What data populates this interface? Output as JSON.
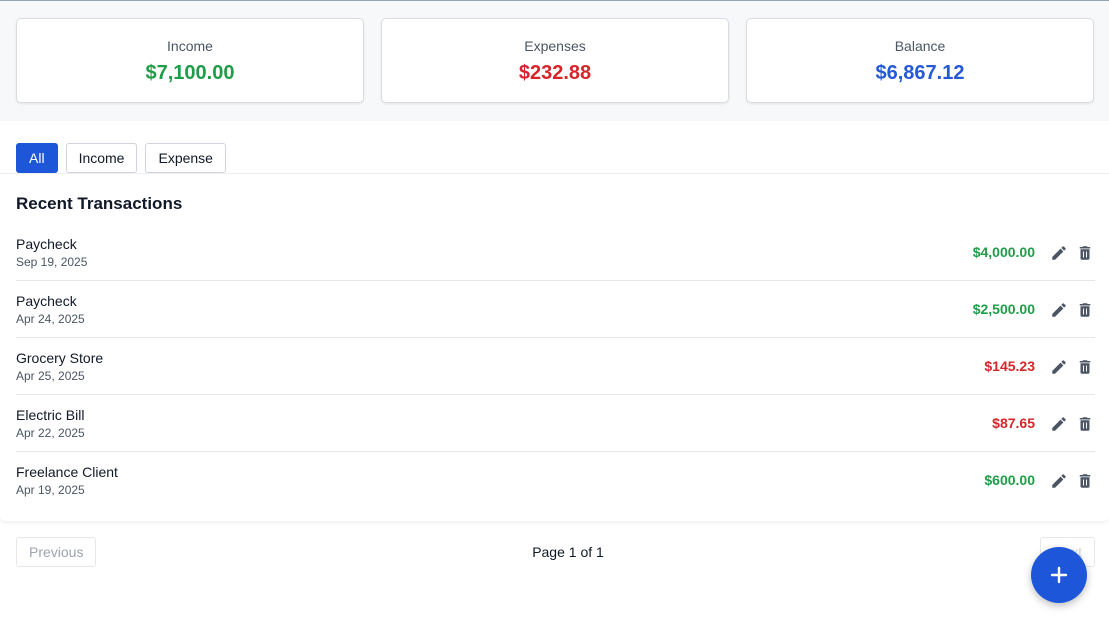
{
  "colors": {
    "income": "#1f9d48",
    "expense": "#d6252b",
    "balance": "#2559d6",
    "accent": "#1d56d8",
    "icon": "#4b5563"
  },
  "summary": {
    "income": {
      "label": "Income",
      "value": "$7,100.00"
    },
    "expenses": {
      "label": "Expenses",
      "value": "$232.88"
    },
    "balance": {
      "label": "Balance",
      "value": "$6,867.12"
    }
  },
  "filters": {
    "all": "All",
    "income": "Income",
    "expense": "Expense",
    "selected": "All"
  },
  "transactions": {
    "title": "Recent Transactions",
    "items": [
      {
        "name": "Paycheck",
        "date": "Sep 19, 2025",
        "amount": "$4,000.00",
        "type": "income"
      },
      {
        "name": "Paycheck",
        "date": "Apr 24, 2025",
        "amount": "$2,500.00",
        "type": "income"
      },
      {
        "name": "Grocery Store",
        "date": "Apr 25, 2025",
        "amount": "$145.23",
        "type": "expense"
      },
      {
        "name": "Electric Bill",
        "date": "Apr 22, 2025",
        "amount": "$87.65",
        "type": "expense"
      },
      {
        "name": "Freelance Client",
        "date": "Apr 19, 2025",
        "amount": "$600.00",
        "type": "income"
      }
    ],
    "icons": {
      "edit": "pencil-icon",
      "delete": "trash-icon"
    }
  },
  "pagination": {
    "previous": "Previous",
    "next": "Next",
    "info": "Page 1 of 1"
  },
  "fab": {
    "icon": "plus-icon"
  }
}
